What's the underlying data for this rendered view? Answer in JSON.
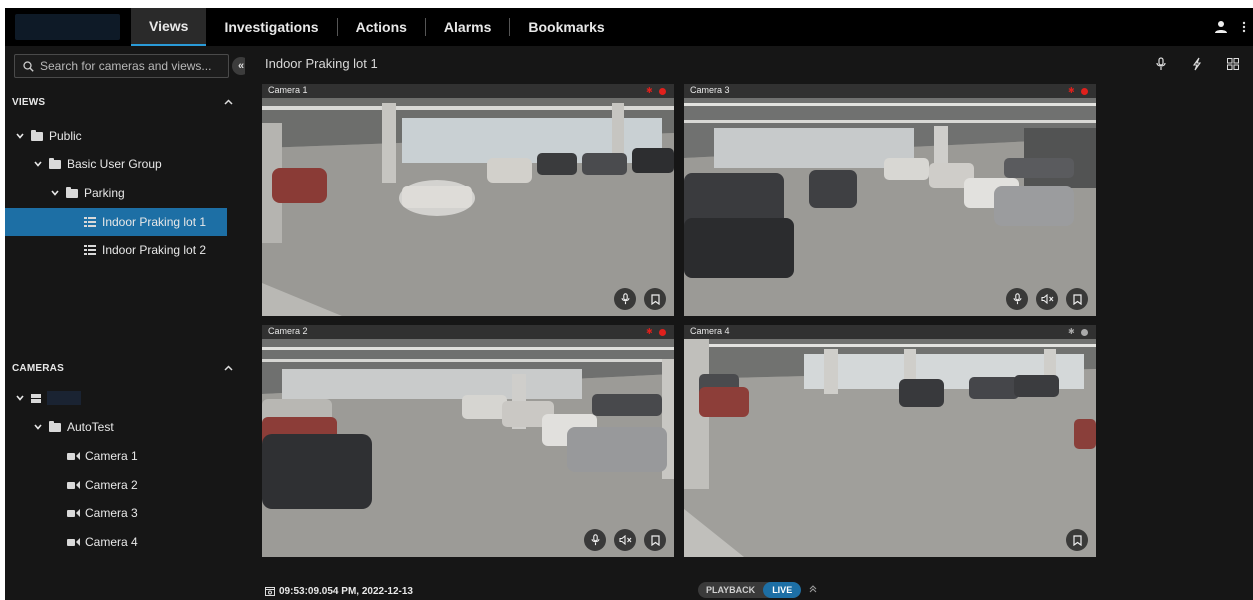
{
  "topbar": {
    "tabs": [
      {
        "label": "Views",
        "active": true
      },
      {
        "label": "Investigations",
        "active": false
      },
      {
        "label": "Actions",
        "active": false
      },
      {
        "label": "Alarms",
        "active": false
      },
      {
        "label": "Bookmarks",
        "active": false
      }
    ],
    "icons": [
      "user-icon",
      "kebab-menu-icon"
    ]
  },
  "sidebar": {
    "search_placeholder": "Search for cameras and views...",
    "views_header": "VIEWS",
    "views_tree": [
      {
        "label": "Public",
        "type": "folder",
        "depth": 0,
        "expanded": true
      },
      {
        "label": "Basic User Group",
        "type": "folder",
        "depth": 1,
        "expanded": true
      },
      {
        "label": "Parking",
        "type": "folder",
        "depth": 2,
        "expanded": true
      },
      {
        "label": "Indoor Praking lot 1",
        "type": "view",
        "depth": 3,
        "selected": true
      },
      {
        "label": "Indoor Praking lot 2",
        "type": "view",
        "depth": 3,
        "selected": false
      }
    ],
    "cameras_header": "CAMERAS",
    "cameras_tree": [
      {
        "label": "",
        "type": "server",
        "depth": 0,
        "expanded": true
      },
      {
        "label": "AutoTest",
        "type": "folder",
        "depth": 1,
        "expanded": true
      },
      {
        "label": "Camera 1",
        "type": "camera",
        "depth": 2
      },
      {
        "label": "Camera 2",
        "type": "camera",
        "depth": 2
      },
      {
        "label": "Camera 3",
        "type": "camera",
        "depth": 2
      },
      {
        "label": "Camera 4",
        "type": "camera",
        "depth": 2
      }
    ]
  },
  "main": {
    "view_title": "Indoor Praking lot 1",
    "toolbar_icons": [
      "microphone-icon",
      "lightning-icon",
      "layout-grid-icon"
    ],
    "tiles": [
      {
        "name": "Camera 1",
        "recording": true,
        "buttons": [
          "microphone",
          "bookmark"
        ]
      },
      {
        "name": "Camera 3",
        "recording": true,
        "buttons": [
          "microphone",
          "mute",
          "bookmark"
        ]
      },
      {
        "name": "Camera 2",
        "recording": true,
        "buttons": [
          "microphone",
          "mute",
          "bookmark"
        ]
      },
      {
        "name": "Camera 4",
        "recording": false,
        "buttons": [
          "bookmark"
        ]
      }
    ],
    "timestamp": "09:53:09.054 PM, 2022-12-13",
    "mode": {
      "playback": "PLAYBACK",
      "live": "LIVE",
      "active": "live"
    }
  },
  "colors": {
    "accent": "#1d6fa5",
    "tab_underline": "#2a9bd8",
    "recording": "#e0201c",
    "background": "#161616"
  }
}
